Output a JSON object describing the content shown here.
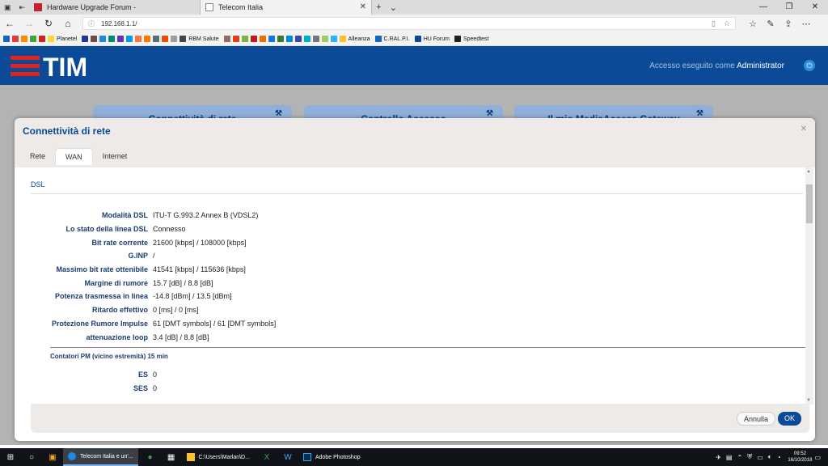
{
  "browser": {
    "tabs": [
      {
        "title": "Hardware Upgrade Forum -"
      },
      {
        "title": "Telecom Italia"
      }
    ],
    "url": "192.168.1.1/",
    "favorites": [
      "Planetel",
      "RBM Salute",
      "Alleanza",
      "C.RAL.P.I.",
      "HU Forum",
      "Speedtest"
    ]
  },
  "header": {
    "logo": "TIM",
    "login_prefix": "Accesso eseguito come",
    "login_user": "Administrator"
  },
  "background_cards": [
    "Connettività di rete",
    "Controllo Accesso",
    "Il mio MediaAccess Gateway"
  ],
  "modal": {
    "title": "Connettività di rete",
    "tabs": [
      "Rete",
      "WAN",
      "Internet"
    ],
    "active_tab": "WAN",
    "section": "DSL",
    "rows": [
      {
        "label": "Modalità DSL",
        "value": "ITU-T G.993.2 Annex B (VDSL2)"
      },
      {
        "label": "Lo stato della linea DSL",
        "value": "Connesso"
      },
      {
        "label": "Bit rate corrente",
        "value": "21600 [kbps] / 108000 [kbps]"
      },
      {
        "label": "G.INP",
        "value": "/"
      },
      {
        "label": "Massimo bit rate ottenibile",
        "value": "41541 [kbps] / 115636 [kbps]"
      },
      {
        "label": "Margine di rumore",
        "value": "15.7 [dB] / 8.8 [dB]"
      },
      {
        "label": "Potenza trasmessa in linea",
        "value": "-14.8 [dBm] / 13.5 [dBm]"
      },
      {
        "label": "Ritardo effettivo",
        "value": "0 [ms] / 0 [ms]"
      },
      {
        "label": "Protezione Rumore Impulse",
        "value": "61 [DMT symbols] / 61 [DMT symbols]"
      },
      {
        "label": "attenuazione loop",
        "value": "3.4 [dB] / 8.8 [dB]"
      }
    ],
    "pm_title": "Contatori PM (vicino estremità) 15 min",
    "pm_rows": [
      {
        "label": "ES",
        "value": "0"
      },
      {
        "label": "SES",
        "value": "0"
      }
    ],
    "cancel_label": "Annulla",
    "ok_label": "OK"
  },
  "taskbar": {
    "apps": [
      "Telecom Italia e un'...",
      "C:\\Users\\Marlan\\D...",
      "Adobe Photoshop"
    ],
    "time": "09:52",
    "date": "16/10/2018"
  }
}
